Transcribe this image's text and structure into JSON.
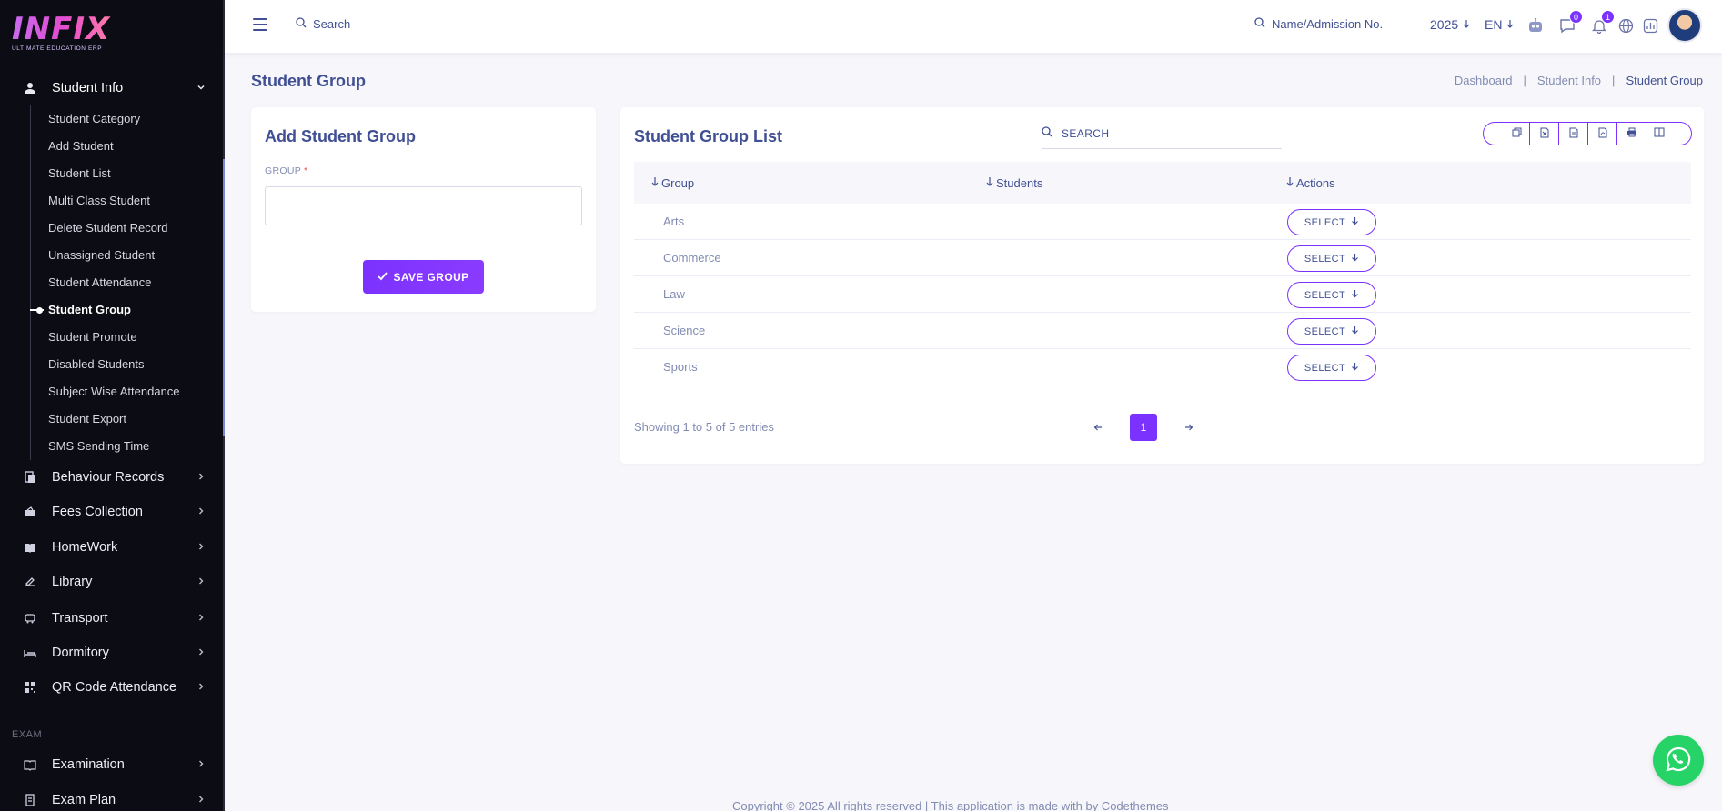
{
  "brand": {
    "logo_word": "INFIX",
    "logo_tagline": "ULTIMATE EDUCATION ERP"
  },
  "sidebar": {
    "active_menu": {
      "label": "Student Info",
      "icon": "user-icon"
    },
    "sub_items": [
      {
        "label": "Student Category"
      },
      {
        "label": "Add Student"
      },
      {
        "label": "Student List"
      },
      {
        "label": "Multi Class Student"
      },
      {
        "label": "Delete Student Record"
      },
      {
        "label": "Unassigned Student"
      },
      {
        "label": "Student Attendance"
      },
      {
        "label": "Student Group",
        "active": true
      },
      {
        "label": "Student Promote"
      },
      {
        "label": "Disabled Students"
      },
      {
        "label": "Subject Wise Attendance"
      },
      {
        "label": "Student Export"
      },
      {
        "label": "SMS Sending Time"
      }
    ],
    "menus": [
      {
        "label": "Behaviour Records",
        "icon": "behaviour-icon"
      },
      {
        "label": "Fees Collection",
        "icon": "fees-icon"
      },
      {
        "label": "HomeWork",
        "icon": "homework-icon"
      },
      {
        "label": "Library",
        "icon": "library-icon"
      },
      {
        "label": "Transport",
        "icon": "transport-icon"
      },
      {
        "label": "Dormitory",
        "icon": "dormitory-icon"
      },
      {
        "label": "QR Code Attendance",
        "icon": "qr-icon"
      }
    ],
    "section_exam": "EXAM",
    "exam_menus": [
      {
        "label": "Examination",
        "icon": "examination-icon"
      },
      {
        "label": "Exam Plan",
        "icon": "exam-plan-icon"
      }
    ]
  },
  "header": {
    "search_label": "Search",
    "name_search_label": "Name/Admission No.",
    "year": "2025",
    "language": "EN",
    "messages_count": "0",
    "notifications_count": "1"
  },
  "page": {
    "title": "Student Group",
    "breadcrumb": [
      "Dashboard",
      "Student Info",
      "Student Group"
    ]
  },
  "add_form": {
    "title": "Add Student Group",
    "group_label": "GROUP",
    "required_mark": "*",
    "group_value": "",
    "save_label": "SAVE GROUP"
  },
  "list": {
    "title": "Student Group List",
    "search_placeholder": "SEARCH",
    "columns": [
      "Group",
      "Students",
      "Actions"
    ],
    "rows": [
      {
        "group": "Arts",
        "students": "",
        "action": "SELECT"
      },
      {
        "group": "Commerce",
        "students": "",
        "action": "SELECT"
      },
      {
        "group": "Law",
        "students": "",
        "action": "SELECT"
      },
      {
        "group": "Science",
        "students": "",
        "action": "SELECT"
      },
      {
        "group": "Sports",
        "students": "",
        "action": "SELECT"
      }
    ],
    "showing_text": "Showing 1 to 5 of 5 entries",
    "current_page": "1"
  },
  "footer": {
    "text": "Copyright © 2025 All rights reserved | This application is made with by Codethemes"
  },
  "colors": {
    "accent": "#7c32ff",
    "text": "#415094",
    "muted": "#828bb2",
    "sidebar_bg": "#0c0c14",
    "whatsapp": "#25d366"
  }
}
